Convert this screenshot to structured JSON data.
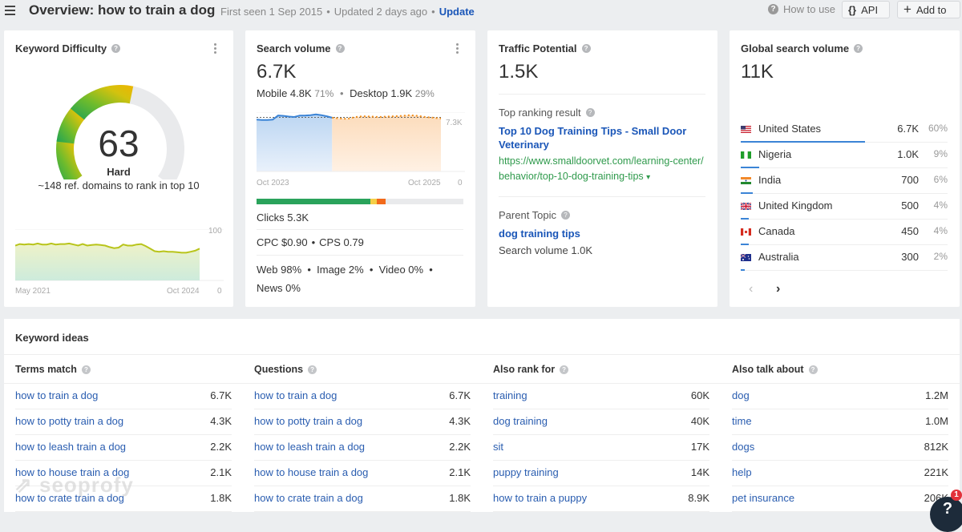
{
  "header": {
    "title": "Overview: how to train a dog",
    "first_seen": "First seen 1 Sep 2015",
    "updated": "Updated 2 days ago",
    "separator": "•",
    "update_label": "Update",
    "how_to_use": "How to use",
    "api_label": "API",
    "api_icon": "{}",
    "add_to_label": "Add to",
    "add_icon": "+",
    "help_icon": "?"
  },
  "keyword_difficulty": {
    "title": "Keyword Difficulty",
    "help_icon": "?",
    "score": "63",
    "score_value": 63,
    "label": "Hard",
    "subtitle": "~148 ref. domains to rank in top 10",
    "colors": {
      "green_dark": "#1aa158",
      "green": "#6dbb2d",
      "yellow": "#d4c20e",
      "orange": "#f0b400",
      "empty": "#e9eaec"
    },
    "history_chart": {
      "type": "area",
      "x_start": "May 2021",
      "x_end": "Oct 2024",
      "y_max_label": "100",
      "y_min_label": "0",
      "ylim": [
        0,
        100
      ],
      "values": [
        68,
        71,
        70,
        71,
        70,
        72,
        70,
        70,
        72,
        70,
        71,
        71,
        72,
        70,
        68,
        71,
        68,
        69,
        70,
        69,
        68,
        65,
        63,
        64,
        70,
        68,
        68,
        70,
        71,
        67,
        62,
        57,
        56,
        57,
        56,
        56,
        55,
        54,
        54,
        56,
        58,
        62
      ]
    }
  },
  "search_volume": {
    "title": "Search volume",
    "help_icon": "?",
    "value": "6.7K",
    "mobile_label": "Mobile 4.8K",
    "mobile_pct": "71%",
    "desktop_label": "Desktop 1.9K",
    "desktop_pct": "29%",
    "separator": "•",
    "chart": {
      "type": "area",
      "x_start": "Oct 2023",
      "x_end": "Oct 2025",
      "y_max_label": "7.3K",
      "y_min_label": "0",
      "ylim": [
        0,
        8000
      ],
      "reference_line": 7300,
      "history": [
        7000,
        6950,
        6950,
        7000,
        7550,
        7500,
        7400,
        7350,
        7550,
        7550,
        7600,
        7700,
        7600,
        7450,
        7250
      ],
      "forecast": [
        7250,
        7150,
        7100,
        7350,
        7450,
        7400,
        7350,
        7400,
        7450,
        7500,
        7600,
        7500,
        7350,
        7250,
        7150
      ],
      "colors": {
        "history": "#3b84d6",
        "forecast": "#f28f1c"
      }
    },
    "clicks_distribution": {
      "segments": [
        {
          "name": "organic",
          "fraction": 0.55,
          "color": "#2aa35b"
        },
        {
          "name": "paid",
          "fraction": 0.03,
          "color": "#f5cf47"
        },
        {
          "name": "other",
          "fraction": 0.045,
          "color": "#f26a1b"
        }
      ]
    },
    "clicks": "Clicks 5.3K",
    "cpc": "CPC $0.90",
    "cps": "CPS 0.79",
    "serp_types": "Web 98%  •  Image 2%  •  Video 0%  •",
    "serp_types_2": "News 0%"
  },
  "traffic_potential": {
    "title": "Traffic Potential",
    "help_icon": "?",
    "value": "1.5K",
    "top_ranking_label": "Top ranking result",
    "top_result_title": "Top 10 Dog Training Tips - Small Door Veterinary",
    "top_result_url": "https://www.smalldoorvet.com/learning-center/behavior/top-10-dog-training-tips",
    "url_dropdown_icon": "▾",
    "parent_topic_label": "Parent Topic",
    "parent_topic": "dog training tips",
    "parent_volume": "Search volume 1.0K"
  },
  "global_volume": {
    "title": "Global search volume",
    "help_icon": "?",
    "value": "11K",
    "countries": [
      {
        "name": "United States",
        "volume": "6.7K",
        "pct": "60%",
        "share": 0.6,
        "flag": "us"
      },
      {
        "name": "Nigeria",
        "volume": "1.0K",
        "pct": "9%",
        "share": 0.09,
        "flag": "ng"
      },
      {
        "name": "India",
        "volume": "700",
        "pct": "6%",
        "share": 0.06,
        "flag": "in"
      },
      {
        "name": "United Kingdom",
        "volume": "500",
        "pct": "4%",
        "share": 0.04,
        "flag": "gb"
      },
      {
        "name": "Canada",
        "volume": "450",
        "pct": "4%",
        "share": 0.04,
        "flag": "ca"
      },
      {
        "name": "Australia",
        "volume": "300",
        "pct": "2%",
        "share": 0.02,
        "flag": "au"
      }
    ],
    "prev_icon": "‹",
    "next_icon": "›"
  },
  "keyword_ideas": {
    "title": "Keyword ideas",
    "columns": [
      {
        "title": "Terms match",
        "items": [
          {
            "kw": "how to train a dog",
            "vol": "6.7K"
          },
          {
            "kw": "how to potty train a dog",
            "vol": "4.3K"
          },
          {
            "kw": "how to leash train a dog",
            "vol": "2.2K"
          },
          {
            "kw": "how to house train a dog",
            "vol": "2.1K"
          },
          {
            "kw": "how to crate train a dog",
            "vol": "1.8K"
          }
        ]
      },
      {
        "title": "Questions",
        "items": [
          {
            "kw": "how to train a dog",
            "vol": "6.7K"
          },
          {
            "kw": "how to potty train a dog",
            "vol": "4.3K"
          },
          {
            "kw": "how to leash train a dog",
            "vol": "2.2K"
          },
          {
            "kw": "how to house train a dog",
            "vol": "2.1K"
          },
          {
            "kw": "how to crate train a dog",
            "vol": "1.8K"
          }
        ]
      },
      {
        "title": "Also rank for",
        "items": [
          {
            "kw": "training",
            "vol": "60K"
          },
          {
            "kw": "dog training",
            "vol": "40K"
          },
          {
            "kw": "sit",
            "vol": "17K"
          },
          {
            "kw": "puppy training",
            "vol": "14K"
          },
          {
            "kw": "how to train a puppy",
            "vol": "8.9K"
          }
        ]
      },
      {
        "title": "Also talk about",
        "items": [
          {
            "kw": "dog",
            "vol": "1.2M"
          },
          {
            "kw": "time",
            "vol": "1.0M"
          },
          {
            "kw": "dogs",
            "vol": "812K"
          },
          {
            "kw": "help",
            "vol": "221K"
          },
          {
            "kw": "pet insurance",
            "vol": "206K"
          }
        ]
      }
    ]
  },
  "watermark": "seoprofy",
  "help_widget": {
    "icon": "?",
    "badge": "1"
  }
}
